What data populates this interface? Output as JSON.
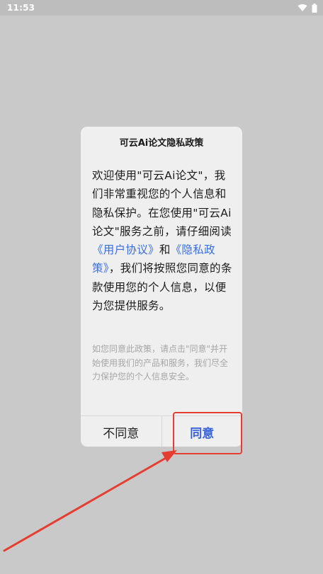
{
  "status_bar": {
    "time": "11:53",
    "icons": [
      "wifi-icon",
      "battery-icon"
    ]
  },
  "dialog": {
    "title": "可云Ai论文隐私政策",
    "body": {
      "intro": "欢迎使用\"可云Ai论文\"，我们非常重视您的个人信息和隐私保护。在您使用\"可云Ai论文\"服务之前，请仔细阅读",
      "user_agreement_link": "《用户协议》",
      "and": "和",
      "privacy_policy_link": "《隐私政策》",
      "outro": "，我们将按照您同意的条款使用您的个人信息，以便为您提供服务。"
    },
    "note": "如您同意此政策，请点击\"同意\"并开始使用我们的产品和服务，我们尽全力保护您的个人信息安全。",
    "buttons": {
      "disagree": "不同意",
      "agree": "同意"
    }
  },
  "annotation": {
    "color": "#e53e30"
  },
  "colors": {
    "background": "#c9c9c9",
    "dialog": "#efefef",
    "link": "#3a6fe0",
    "agree": "#3a63d8"
  }
}
